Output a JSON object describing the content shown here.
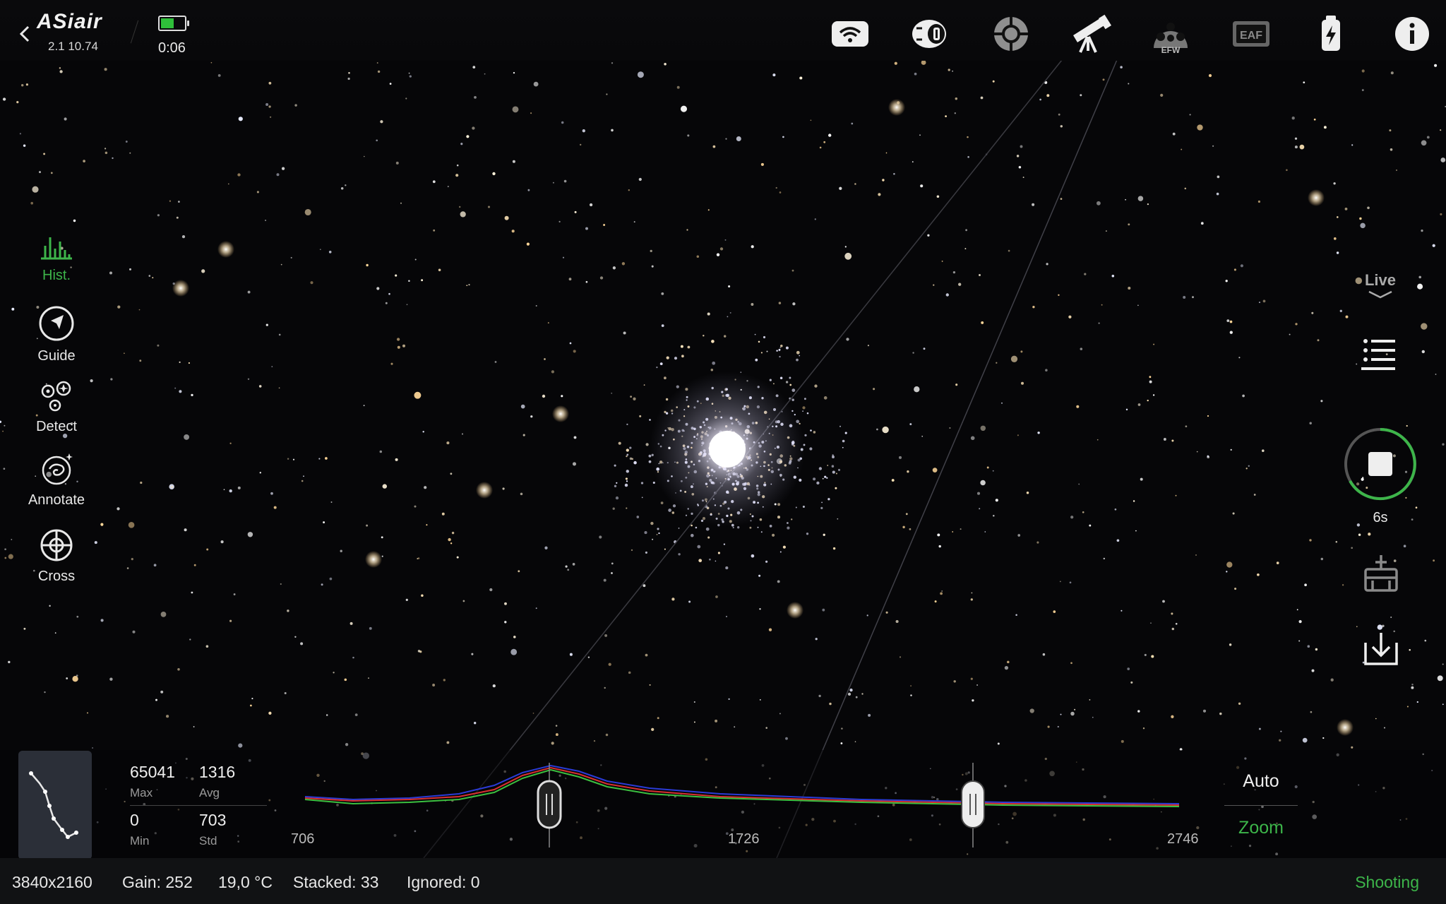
{
  "app": {
    "logo_text": "ASiair",
    "version": "2.1 10.74",
    "battery_level": 0.55,
    "elapsed": "0:06"
  },
  "top_icons": [
    "wifi-icon",
    "camera-icon",
    "guide-camera-icon",
    "telescope-icon",
    "efw-icon",
    "eaf-icon",
    "power-bank-icon",
    "info-icon"
  ],
  "top_icon_labels": {
    "efw": "EFW",
    "eaf": "EAF"
  },
  "left_tools": [
    {
      "label": "Hist.",
      "icon": "histogram-icon",
      "active": true
    },
    {
      "label": "Guide",
      "icon": "guide-icon",
      "active": false
    },
    {
      "label": "Detect",
      "icon": "detect-icon",
      "active": false
    },
    {
      "label": "Annotate",
      "icon": "annotate-icon",
      "active": false
    },
    {
      "label": "Cross",
      "icon": "crosshair-icon",
      "active": false
    }
  ],
  "right_tools": {
    "mode_label": "Live",
    "exposure_label": "6s",
    "icons": [
      "list-icon",
      "stop-icon",
      "clear-icon",
      "download-icon"
    ]
  },
  "histogram": {
    "max_value": "65041",
    "max_label": "Max",
    "avg_value": "1316",
    "avg_label": "Avg",
    "min_value": "0",
    "min_label": "Min",
    "std_value": "703",
    "std_label": "Std",
    "axis_left": "706",
    "axis_mid": "1726",
    "axis_right": "2746",
    "auto_label": "Auto",
    "zoom_label": "Zoom"
  },
  "status_bar": {
    "resolution": "3840x2160",
    "gain": "Gain: 252",
    "temperature": "19,0 °C",
    "stacked": "Stacked: 33",
    "ignored": "Ignored: 0",
    "state": "Shooting"
  },
  "colors": {
    "accent_green": "#3db54a",
    "sky": "#060608"
  }
}
